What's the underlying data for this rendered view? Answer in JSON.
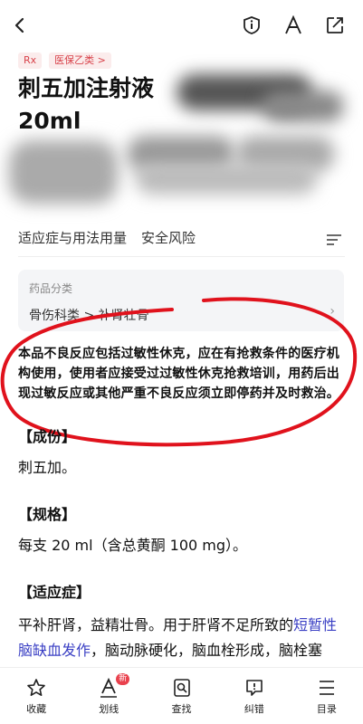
{
  "tags": {
    "rx": "Rx",
    "insurance": "医保乙类 >"
  },
  "drug": {
    "name": "刺五加注射液 20ml"
  },
  "tabs": {
    "indications": "适应症与用法用量",
    "safety": "安全风险"
  },
  "category": {
    "label": "药品分类",
    "path": "骨伤科类 > 补肾壮骨",
    "arrow": "›"
  },
  "warning": "本品不良反应包括过敏性休克，应在有抢救条件的医疗机构使用，使用者应接受过过敏性休克抢救培训，用药后出现过敏反应或其他严重不良反应须立即停药并及时救治。",
  "sections": {
    "ingredients_heading": "【成份】",
    "ingredients_text": "刺五加。",
    "spec_heading": "【规格】",
    "spec_text": "每支 20 ml（含总黄酮 100 mg）。",
    "indication_heading": "【适应症】",
    "indication_text_1": "平补肝肾，益精壮骨。用于肝肾不足所致的",
    "indication_link_1": "短暂性脑缺血发作",
    "indication_text_2": "，脑动脉硬化，脑血栓形成，脑栓塞"
  },
  "bottom_nav": {
    "collect": "收藏",
    "highlight": "划线",
    "highlight_badge": "新",
    "find": "查找",
    "correct": "纠错",
    "toc": "目录"
  },
  "colors": {
    "accent": "#d8424a",
    "link": "#3a3fc4",
    "annotation": "#e0121c"
  },
  "icons": [
    "back-icon",
    "info-icon",
    "font-icon",
    "share-icon",
    "menu-icon",
    "star-icon",
    "highlight-icon",
    "find-icon",
    "correct-icon",
    "toc-icon"
  ]
}
